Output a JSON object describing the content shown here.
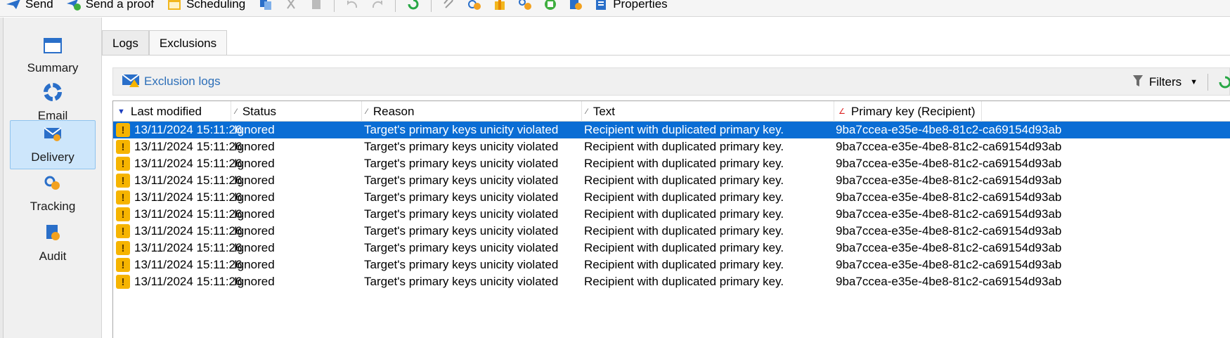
{
  "toolbar": {
    "send": "Send",
    "send_proof": "Send a proof",
    "scheduling": "Scheduling",
    "properties": "Properties"
  },
  "sidebar": {
    "items": [
      {
        "label": "Summary",
        "icon": "summary-icon"
      },
      {
        "label": "Email",
        "icon": "email-icon"
      },
      {
        "label": "Delivery",
        "icon": "delivery-icon",
        "active": true
      },
      {
        "label": "Tracking",
        "icon": "tracking-icon"
      },
      {
        "label": "Audit",
        "icon": "audit-icon"
      }
    ]
  },
  "tabs": [
    {
      "label": "Logs"
    },
    {
      "label": "Exclusions",
      "active": true
    }
  ],
  "panel": {
    "title": "Exclusion logs",
    "filters_label": "Filters"
  },
  "table": {
    "columns": [
      "Last modified",
      "Status",
      "Reason",
      "Text",
      "Primary key (Recipient)"
    ],
    "rows": [
      {
        "date": "13/11/2024 15:11:26",
        "status": "Ignored",
        "reason": "Target's primary keys unicity violated",
        "text": "Recipient with duplicated primary key.",
        "pk": "9ba7ccea-e35e-4be8-81c2-ca69154d93ab"
      },
      {
        "date": "13/11/2024 15:11:26",
        "status": "Ignored",
        "reason": "Target's primary keys unicity violated",
        "text": "Recipient with duplicated primary key.",
        "pk": "9ba7ccea-e35e-4be8-81c2-ca69154d93ab"
      },
      {
        "date": "13/11/2024 15:11:26",
        "status": "Ignored",
        "reason": "Target's primary keys unicity violated",
        "text": "Recipient with duplicated primary key.",
        "pk": "9ba7ccea-e35e-4be8-81c2-ca69154d93ab"
      },
      {
        "date": "13/11/2024 15:11:26",
        "status": "Ignored",
        "reason": "Target's primary keys unicity violated",
        "text": "Recipient with duplicated primary key.",
        "pk": "9ba7ccea-e35e-4be8-81c2-ca69154d93ab"
      },
      {
        "date": "13/11/2024 15:11:26",
        "status": "Ignored",
        "reason": "Target's primary keys unicity violated",
        "text": "Recipient with duplicated primary key.",
        "pk": "9ba7ccea-e35e-4be8-81c2-ca69154d93ab"
      },
      {
        "date": "13/11/2024 15:11:26",
        "status": "Ignored",
        "reason": "Target's primary keys unicity violated",
        "text": "Recipient with duplicated primary key.",
        "pk": "9ba7ccea-e35e-4be8-81c2-ca69154d93ab"
      },
      {
        "date": "13/11/2024 15:11:26",
        "status": "Ignored",
        "reason": "Target's primary keys unicity violated",
        "text": "Recipient with duplicated primary key.",
        "pk": "9ba7ccea-e35e-4be8-81c2-ca69154d93ab"
      },
      {
        "date": "13/11/2024 15:11:26",
        "status": "Ignored",
        "reason": "Target's primary keys unicity violated",
        "text": "Recipient with duplicated primary key.",
        "pk": "9ba7ccea-e35e-4be8-81c2-ca69154d93ab"
      },
      {
        "date": "13/11/2024 15:11:26",
        "status": "Ignored",
        "reason": "Target's primary keys unicity violated",
        "text": "Recipient with duplicated primary key.",
        "pk": "9ba7ccea-e35e-4be8-81c2-ca69154d93ab"
      },
      {
        "date": "13/11/2024 15:11:26",
        "status": "Ignored",
        "reason": "Target's primary keys unicity violated",
        "text": "Recipient with duplicated primary key.",
        "pk": "9ba7ccea-e35e-4be8-81c2-ca69154d93ab"
      }
    ],
    "selected_row": 0
  },
  "colors": {
    "selection": "#0a6dd4",
    "accent_blue": "#2d6fb8",
    "warning": "#f6b400",
    "active_nav": "#cde6fb"
  }
}
